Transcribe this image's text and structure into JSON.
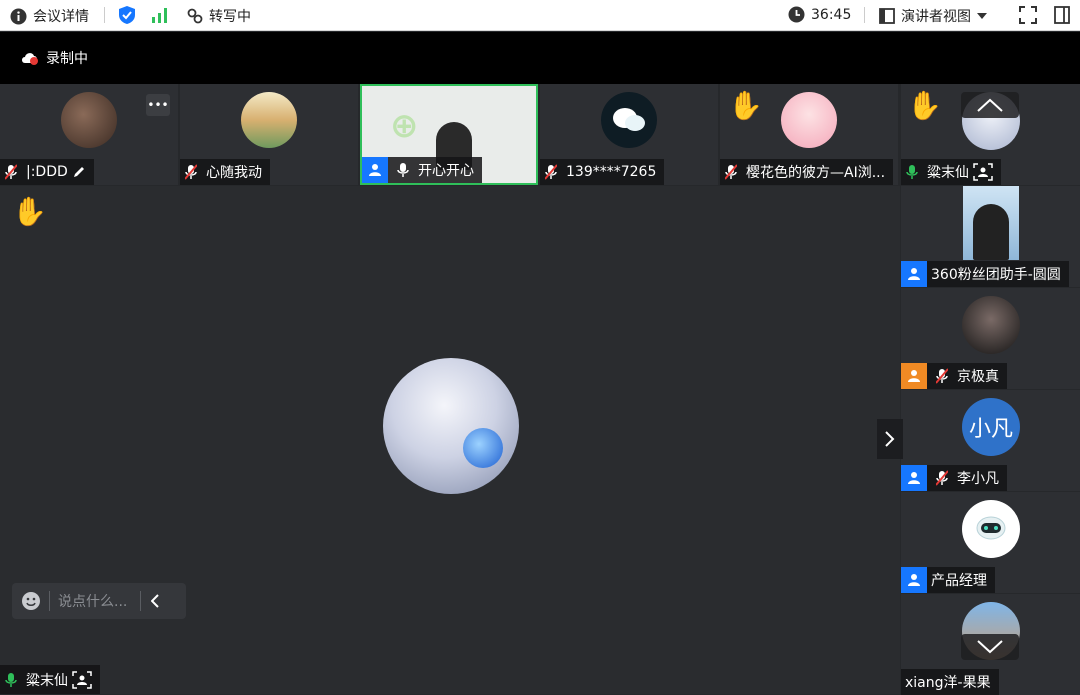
{
  "topbar": {
    "meeting_details": "会议详情",
    "transcribing": "转写中",
    "timer": "36:45",
    "view_mode": "演讲者视图"
  },
  "recording": {
    "label": "录制中"
  },
  "thumbnails": [
    {
      "name": "|:DDD"
    },
    {
      "name": "心随我动"
    },
    {
      "name": "开心开心"
    },
    {
      "name": "139****7265"
    },
    {
      "name": "樱花色的彼方—AI浏..."
    }
  ],
  "right_column": [
    {
      "name": "粱末仙"
    },
    {
      "name": "360粉丝团助手-圆圆"
    },
    {
      "name": "京极真"
    },
    {
      "name": "李小凡",
      "avatar_text": "小凡"
    },
    {
      "name": "产品经理"
    },
    {
      "name": "xiang洋-果果"
    }
  ],
  "main": {
    "speaker_name": "粱末仙",
    "chat_placeholder": "说点什么..."
  },
  "colors": {
    "accent": "#1677ff",
    "active_border": "#2fbf5a",
    "rec_red": "#e53935",
    "host_orange": "#f08a24"
  }
}
